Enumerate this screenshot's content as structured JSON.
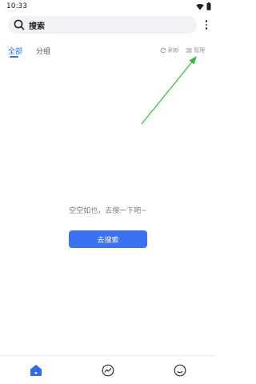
{
  "status_bar": {
    "time": "10:33",
    "icons": [
      "wifi-icon",
      "battery-icon"
    ]
  },
  "search": {
    "placeholder": "搜索",
    "icon": "search-icon"
  },
  "more_menu": {
    "icon": "more-vertical-icon"
  },
  "tabs": [
    {
      "label": "全部",
      "active": true
    },
    {
      "label": "分组",
      "active": false
    }
  ],
  "actions": {
    "refresh": {
      "label": "刷新",
      "icon": "refresh-icon"
    },
    "manage": {
      "label": "管理",
      "icon": "manage-list-icon"
    }
  },
  "empty_state": {
    "message": "空空如也，去搜一下吧~",
    "button_label": "去搜索"
  },
  "bottom_nav": [
    {
      "icon": "home-icon",
      "active": true
    },
    {
      "icon": "trend-icon",
      "active": false
    },
    {
      "icon": "profile-icon",
      "active": false
    }
  ],
  "colors": {
    "accent": "#2f6bf0",
    "button": "#3a72f2",
    "annotation_arrow": "#2ebd3a"
  }
}
